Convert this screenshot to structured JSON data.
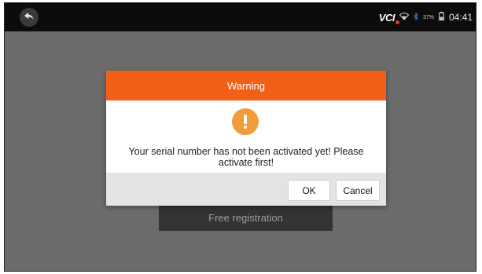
{
  "statusbar": {
    "vci_label": "VCI",
    "battery_label": "37%",
    "time": "04:41",
    "icons": [
      "back-arrow-icon",
      "wifi-icon",
      "bluetooth-icon",
      "battery-icon"
    ]
  },
  "main": {
    "free_registration_label": "Free registration"
  },
  "dialog": {
    "title": "Warning",
    "icon": "warning-icon",
    "message": "Your serial number has not been activated yet! Please activate first!",
    "ok_label": "OK",
    "cancel_label": "Cancel"
  },
  "colors": {
    "header": "#f26018",
    "warning_icon": "#f39a3a",
    "statusbar": "#0c0c0c",
    "overlay": "#6b6b6b"
  }
}
